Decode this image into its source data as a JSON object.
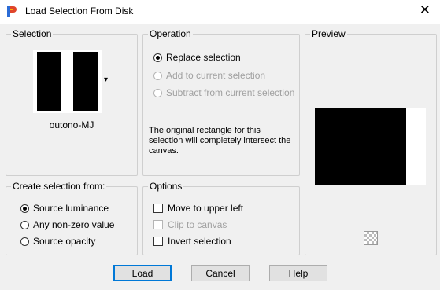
{
  "window": {
    "title": "Load Selection From Disk",
    "close_glyph": "✕"
  },
  "selection": {
    "label": "Selection",
    "preset_name": "outono-MJ",
    "dropdown_glyph": "▾"
  },
  "operation": {
    "label": "Operation",
    "options": [
      {
        "label": "Replace selection",
        "checked": true,
        "enabled": true
      },
      {
        "label": "Add to current selection",
        "checked": false,
        "enabled": false
      },
      {
        "label": "Subtract from current selection",
        "checked": false,
        "enabled": false
      }
    ],
    "info_text": "The original rectangle for this selection will completely intersect the canvas."
  },
  "preview": {
    "label": "Preview"
  },
  "create_from": {
    "label": "Create selection from:",
    "options": [
      {
        "label": "Source luminance",
        "checked": true
      },
      {
        "label": "Any non-zero value",
        "checked": false
      },
      {
        "label": "Source opacity",
        "checked": false
      }
    ]
  },
  "options": {
    "label": "Options",
    "items": [
      {
        "label": "Move to upper left",
        "checked": false,
        "enabled": true
      },
      {
        "label": "Clip to canvas",
        "checked": false,
        "enabled": false
      },
      {
        "label": "Invert selection",
        "checked": false,
        "enabled": true
      }
    ]
  },
  "buttons": {
    "load": "Load",
    "cancel": "Cancel",
    "help": "Help"
  },
  "colors": {
    "accent": "#0078d7",
    "dialog_bg": "#f0f0f0",
    "group_border": "#cfcfcf"
  },
  "icons": {
    "app": "psp-app-icon",
    "zoom": "checkered-zoom-icon"
  }
}
